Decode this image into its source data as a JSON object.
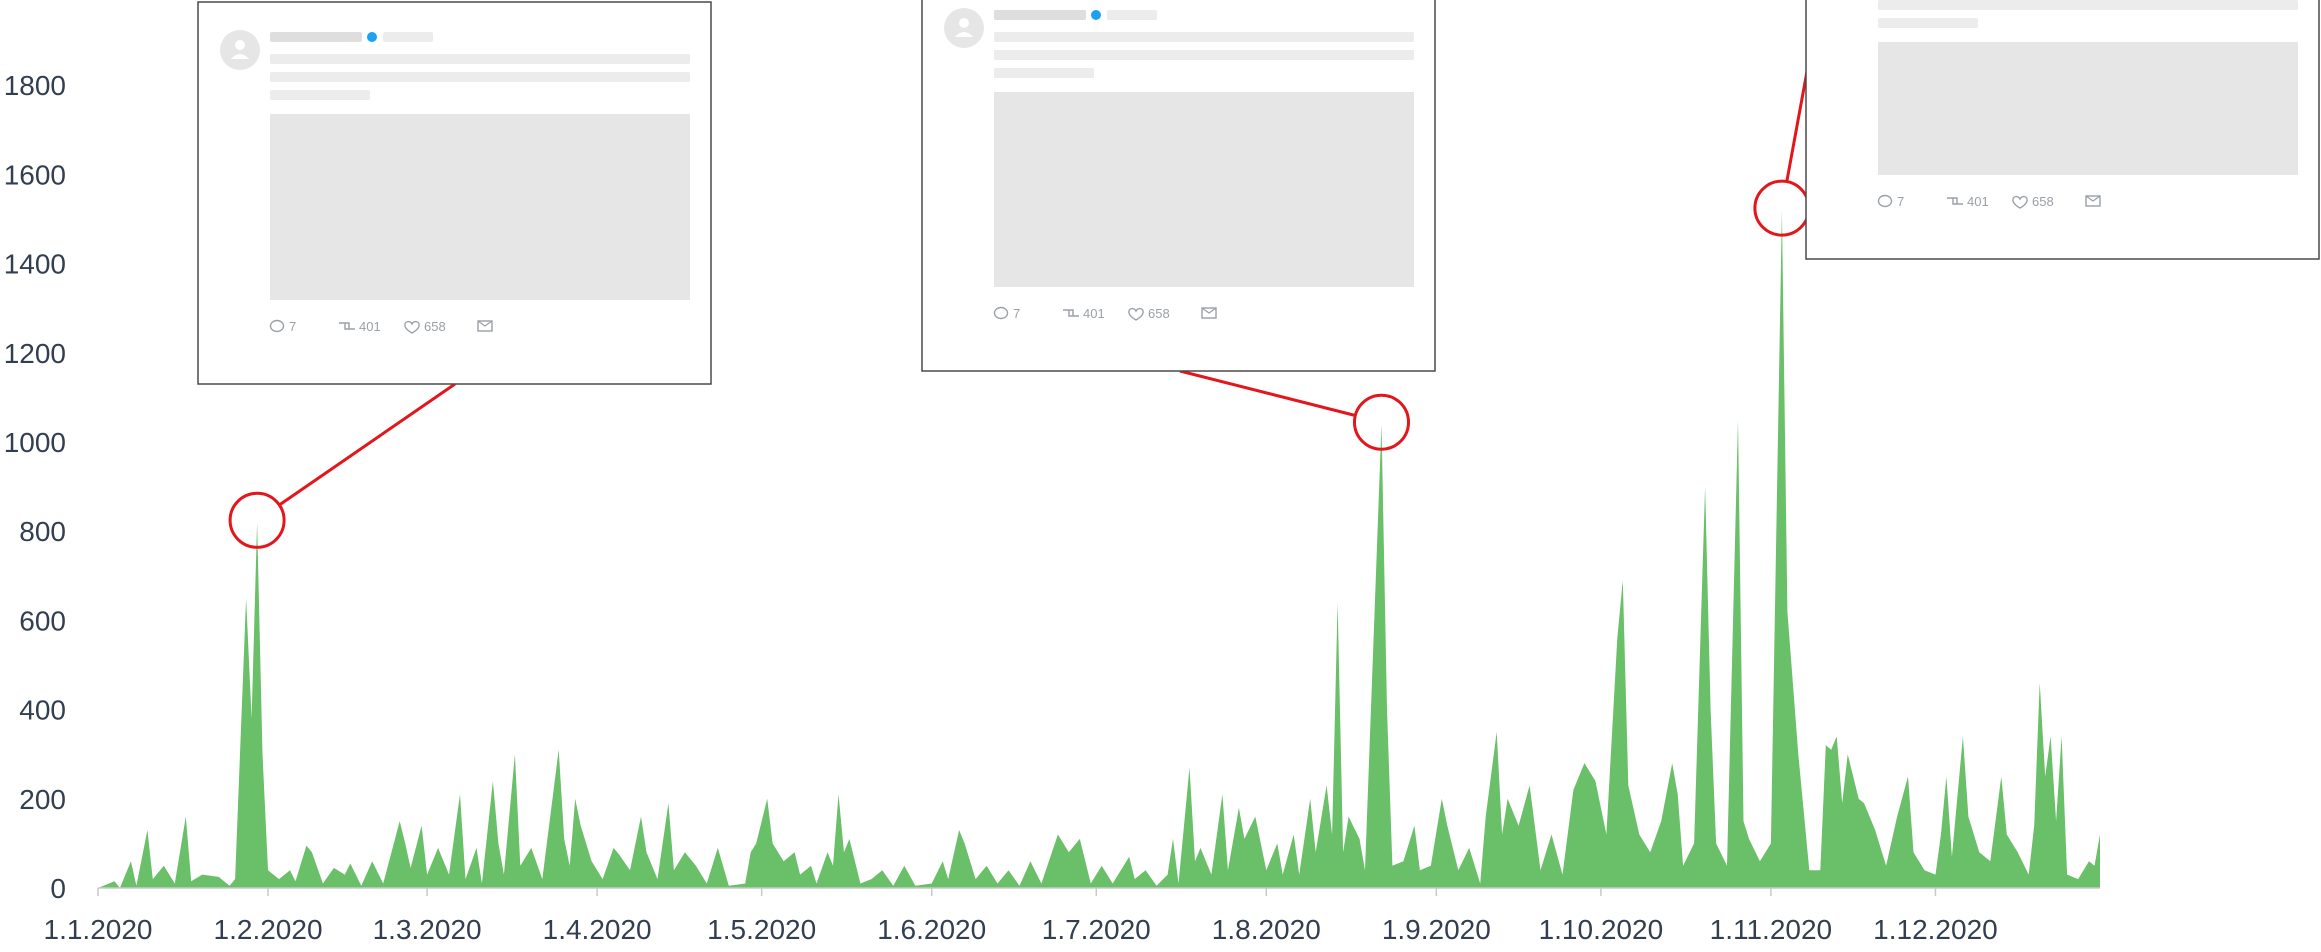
{
  "chart_data": {
    "type": "area",
    "title": "",
    "xlabel": "",
    "ylabel": "",
    "x_start": "2020-01-01",
    "x_end": "2020-12-31",
    "ylim": [
      0,
      1900
    ],
    "yticks": [
      0,
      200,
      400,
      600,
      800,
      1000,
      1200,
      1400,
      1600,
      1800
    ],
    "xticks": [
      {
        "date": "2020-01-01",
        "label": "1.1.2020"
      },
      {
        "date": "2020-02-01",
        "label": "1.2.2020"
      },
      {
        "date": "2020-03-01",
        "label": "1.3.2020"
      },
      {
        "date": "2020-04-01",
        "label": "1.4.2020"
      },
      {
        "date": "2020-05-01",
        "label": "1.5.2020"
      },
      {
        "date": "2020-06-01",
        "label": "1.6.2020"
      },
      {
        "date": "2020-07-01",
        "label": "1.7.2020"
      },
      {
        "date": "2020-08-01",
        "label": "1.8.2020"
      },
      {
        "date": "2020-09-01",
        "label": "1.9.2020"
      },
      {
        "date": "2020-10-01",
        "label": "1.10.2020"
      },
      {
        "date": "2020-11-01",
        "label": "1.11.2020"
      },
      {
        "date": "2020-12-01",
        "label": "1.12.2020"
      }
    ],
    "grid": false,
    "legend": "none",
    "color": "#6abf69",
    "highlight_color": "#e3161b",
    "points": [
      [
        "2020-01-01",
        0
      ],
      [
        "2020-01-04",
        15
      ],
      [
        "2020-01-05",
        0
      ],
      [
        "2020-01-07",
        60
      ],
      [
        "2020-01-08",
        5
      ],
      [
        "2020-01-10",
        130
      ],
      [
        "2020-01-11",
        20
      ],
      [
        "2020-01-13",
        50
      ],
      [
        "2020-01-15",
        10
      ],
      [
        "2020-01-17",
        160
      ],
      [
        "2020-01-18",
        15
      ],
      [
        "2020-01-20",
        30
      ],
      [
        "2020-01-23",
        25
      ],
      [
        "2020-01-25",
        5
      ],
      [
        "2020-01-26",
        20
      ],
      [
        "2020-01-28",
        650
      ],
      [
        "2020-01-29",
        380
      ],
      [
        "2020-01-30",
        820
      ],
      [
        "2020-01-31",
        300
      ],
      [
        "2020-02-01",
        40
      ],
      [
        "2020-02-03",
        20
      ],
      [
        "2020-02-05",
        40
      ],
      [
        "2020-02-06",
        15
      ],
      [
        "2020-02-08",
        95
      ],
      [
        "2020-02-09",
        80
      ],
      [
        "2020-02-11",
        10
      ],
      [
        "2020-02-13",
        45
      ],
      [
        "2020-02-15",
        30
      ],
      [
        "2020-02-16",
        55
      ],
      [
        "2020-02-18",
        5
      ],
      [
        "2020-02-20",
        60
      ],
      [
        "2020-02-22",
        10
      ],
      [
        "2020-02-25",
        150
      ],
      [
        "2020-02-26",
        100
      ],
      [
        "2020-02-27",
        45
      ],
      [
        "2020-02-29",
        140
      ],
      [
        "2020-03-01",
        30
      ],
      [
        "2020-03-03",
        90
      ],
      [
        "2020-03-05",
        30
      ],
      [
        "2020-03-07",
        210
      ],
      [
        "2020-03-08",
        20
      ],
      [
        "2020-03-10",
        90
      ],
      [
        "2020-03-11",
        10
      ],
      [
        "2020-03-13",
        240
      ],
      [
        "2020-03-14",
        100
      ],
      [
        "2020-03-15",
        30
      ],
      [
        "2020-03-17",
        300
      ],
      [
        "2020-03-18",
        50
      ],
      [
        "2020-03-20",
        90
      ],
      [
        "2020-03-22",
        20
      ],
      [
        "2020-03-25",
        310
      ],
      [
        "2020-03-26",
        110
      ],
      [
        "2020-03-27",
        50
      ],
      [
        "2020-03-28",
        200
      ],
      [
        "2020-03-29",
        140
      ],
      [
        "2020-03-31",
        60
      ],
      [
        "2020-04-02",
        20
      ],
      [
        "2020-04-04",
        90
      ],
      [
        "2020-04-05",
        75
      ],
      [
        "2020-04-07",
        40
      ],
      [
        "2020-04-09",
        160
      ],
      [
        "2020-04-10",
        80
      ],
      [
        "2020-04-12",
        20
      ],
      [
        "2020-04-14",
        190
      ],
      [
        "2020-04-15",
        40
      ],
      [
        "2020-04-17",
        80
      ],
      [
        "2020-04-19",
        50
      ],
      [
        "2020-04-21",
        10
      ],
      [
        "2020-04-23",
        90
      ],
      [
        "2020-04-25",
        5
      ],
      [
        "2020-04-28",
        10
      ],
      [
        "2020-04-29",
        80
      ],
      [
        "2020-04-30",
        100
      ],
      [
        "2020-05-02",
        200
      ],
      [
        "2020-05-03",
        100
      ],
      [
        "2020-05-05",
        60
      ],
      [
        "2020-05-07",
        80
      ],
      [
        "2020-05-08",
        30
      ],
      [
        "2020-05-10",
        50
      ],
      [
        "2020-05-11",
        10
      ],
      [
        "2020-05-13",
        80
      ],
      [
        "2020-05-14",
        50
      ],
      [
        "2020-05-15",
        210
      ],
      [
        "2020-05-16",
        80
      ],
      [
        "2020-05-17",
        110
      ],
      [
        "2020-05-19",
        10
      ],
      [
        "2020-05-21",
        20
      ],
      [
        "2020-05-23",
        40
      ],
      [
        "2020-05-25",
        5
      ],
      [
        "2020-05-27",
        50
      ],
      [
        "2020-05-29",
        5
      ],
      [
        "2020-06-01",
        10
      ],
      [
        "2020-06-03",
        60
      ],
      [
        "2020-06-04",
        20
      ],
      [
        "2020-06-06",
        130
      ],
      [
        "2020-06-07",
        100
      ],
      [
        "2020-06-09",
        20
      ],
      [
        "2020-06-11",
        50
      ],
      [
        "2020-06-13",
        10
      ],
      [
        "2020-06-15",
        40
      ],
      [
        "2020-06-17",
        5
      ],
      [
        "2020-06-19",
        60
      ],
      [
        "2020-06-21",
        10
      ],
      [
        "2020-06-24",
        120
      ],
      [
        "2020-06-26",
        80
      ],
      [
        "2020-06-28",
        110
      ],
      [
        "2020-06-30",
        10
      ],
      [
        "2020-07-02",
        50
      ],
      [
        "2020-07-04",
        10
      ],
      [
        "2020-07-07",
        70
      ],
      [
        "2020-07-08",
        20
      ],
      [
        "2020-07-10",
        40
      ],
      [
        "2020-07-12",
        5
      ],
      [
        "2020-07-14",
        30
      ],
      [
        "2020-07-15",
        110
      ],
      [
        "2020-07-16",
        10
      ],
      [
        "2020-07-18",
        270
      ],
      [
        "2020-07-19",
        60
      ],
      [
        "2020-07-20",
        90
      ],
      [
        "2020-07-22",
        30
      ],
      [
        "2020-07-24",
        210
      ],
      [
        "2020-07-25",
        40
      ],
      [
        "2020-07-27",
        180
      ],
      [
        "2020-07-28",
        110
      ],
      [
        "2020-07-30",
        160
      ],
      [
        "2020-08-01",
        40
      ],
      [
        "2020-08-03",
        100
      ],
      [
        "2020-08-04",
        30
      ],
      [
        "2020-08-06",
        120
      ],
      [
        "2020-08-07",
        30
      ],
      [
        "2020-08-09",
        200
      ],
      [
        "2020-08-10",
        80
      ],
      [
        "2020-08-12",
        230
      ],
      [
        "2020-08-13",
        120
      ],
      [
        "2020-08-14",
        640
      ],
      [
        "2020-08-15",
        80
      ],
      [
        "2020-08-16",
        160
      ],
      [
        "2020-08-18",
        110
      ],
      [
        "2020-08-19",
        40
      ],
      [
        "2020-08-22",
        1040
      ],
      [
        "2020-08-23",
        400
      ],
      [
        "2020-08-24",
        50
      ],
      [
        "2020-08-26",
        60
      ],
      [
        "2020-08-28",
        140
      ],
      [
        "2020-08-29",
        40
      ],
      [
        "2020-08-31",
        50
      ],
      [
        "2020-09-02",
        200
      ],
      [
        "2020-09-03",
        140
      ],
      [
        "2020-09-05",
        40
      ],
      [
        "2020-09-07",
        90
      ],
      [
        "2020-09-09",
        10
      ],
      [
        "2020-09-10",
        160
      ],
      [
        "2020-09-12",
        350
      ],
      [
        "2020-09-13",
        120
      ],
      [
        "2020-09-14",
        200
      ],
      [
        "2020-09-16",
        140
      ],
      [
        "2020-09-18",
        230
      ],
      [
        "2020-09-20",
        40
      ],
      [
        "2020-09-22",
        120
      ],
      [
        "2020-09-24",
        30
      ],
      [
        "2020-09-26",
        220
      ],
      [
        "2020-09-28",
        280
      ],
      [
        "2020-09-30",
        240
      ],
      [
        "2020-10-02",
        120
      ],
      [
        "2020-10-04",
        560
      ],
      [
        "2020-10-05",
        690
      ],
      [
        "2020-10-06",
        230
      ],
      [
        "2020-10-08",
        120
      ],
      [
        "2020-10-10",
        80
      ],
      [
        "2020-10-12",
        150
      ],
      [
        "2020-10-14",
        280
      ],
      [
        "2020-10-15",
        210
      ],
      [
        "2020-10-16",
        50
      ],
      [
        "2020-10-18",
        100
      ],
      [
        "2020-10-20",
        900
      ],
      [
        "2020-10-21",
        400
      ],
      [
        "2020-10-22",
        100
      ],
      [
        "2020-10-24",
        50
      ],
      [
        "2020-10-26",
        1050
      ],
      [
        "2020-10-27",
        150
      ],
      [
        "2020-10-28",
        110
      ],
      [
        "2020-10-30",
        60
      ],
      [
        "2020-11-01",
        100
      ],
      [
        "2020-11-03",
        1520
      ],
      [
        "2020-11-04",
        620
      ],
      [
        "2020-11-06",
        300
      ],
      [
        "2020-11-08",
        40
      ],
      [
        "2020-11-10",
        40
      ],
      [
        "2020-11-11",
        320
      ],
      [
        "2020-11-12",
        310
      ],
      [
        "2020-11-13",
        340
      ],
      [
        "2020-11-14",
        190
      ],
      [
        "2020-11-15",
        300
      ],
      [
        "2020-11-17",
        200
      ],
      [
        "2020-11-18",
        190
      ],
      [
        "2020-11-20",
        130
      ],
      [
        "2020-11-22",
        50
      ],
      [
        "2020-11-24",
        160
      ],
      [
        "2020-11-26",
        250
      ],
      [
        "2020-11-27",
        80
      ],
      [
        "2020-11-29",
        40
      ],
      [
        "2020-12-01",
        30
      ],
      [
        "2020-12-02",
        120
      ],
      [
        "2020-12-03",
        250
      ],
      [
        "2020-12-04",
        70
      ],
      [
        "2020-12-06",
        340
      ],
      [
        "2020-12-07",
        160
      ],
      [
        "2020-12-09",
        80
      ],
      [
        "2020-12-11",
        60
      ],
      [
        "2020-12-13",
        250
      ],
      [
        "2020-12-14",
        120
      ],
      [
        "2020-12-16",
        80
      ],
      [
        "2020-12-18",
        30
      ],
      [
        "2020-12-19",
        140
      ],
      [
        "2020-12-20",
        460
      ],
      [
        "2020-12-21",
        250
      ],
      [
        "2020-12-22",
        340
      ],
      [
        "2020-12-23",
        150
      ],
      [
        "2020-12-24",
        340
      ],
      [
        "2020-12-25",
        30
      ],
      [
        "2020-12-27",
        20
      ],
      [
        "2020-12-29",
        60
      ],
      [
        "2020-12-30",
        50
      ],
      [
        "2020-12-31",
        120
      ]
    ],
    "highlights": [
      {
        "date": "2020-01-30",
        "value": 820
      },
      {
        "date": "2020-08-22",
        "value": 1040
      },
      {
        "date": "2020-11-03",
        "value": 1520
      }
    ],
    "tweet_cards": [
      {
        "highlight": 0,
        "replies": "7",
        "retweets": "401",
        "likes": "658"
      },
      {
        "highlight": 1,
        "replies": "7",
        "retweets": "401",
        "likes": "658"
      },
      {
        "highlight": 2,
        "replies": "7",
        "retweets": "401",
        "likes": "658"
      }
    ]
  }
}
